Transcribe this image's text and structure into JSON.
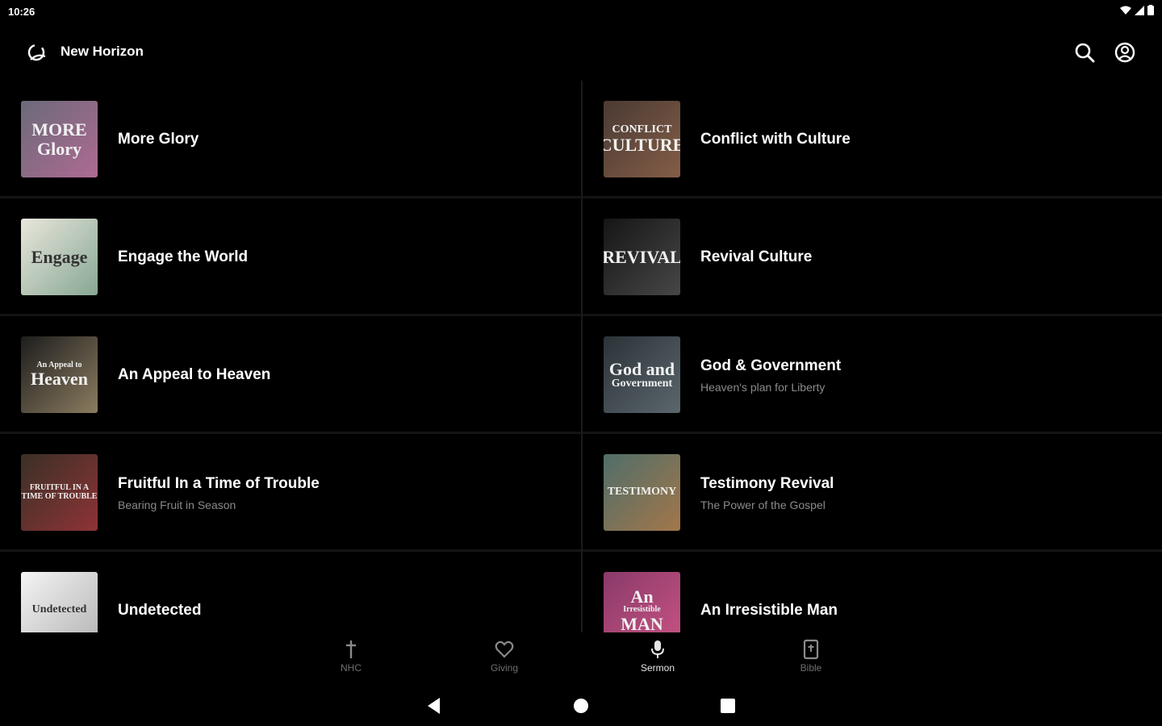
{
  "status_bar": {
    "time": "10:26"
  },
  "app_bar": {
    "title": "New Horizon",
    "logo_icon": "horizon-logo-icon",
    "search_icon": "search-icon",
    "account_icon": "account-circle-icon"
  },
  "series": [
    {
      "title": "More Glory",
      "subtitle": "",
      "thumb_text": [
        "MORE",
        "Glory"
      ],
      "thumb_bg": "#6b6a7a",
      "thumb_accent": "#c96a9c"
    },
    {
      "title": "Conflict with Culture",
      "subtitle": "",
      "thumb_text": [
        "CONFLICT",
        "CULTURE"
      ],
      "thumb_bg": "#4a3a33",
      "thumb_accent": "#9b6b4f"
    },
    {
      "title": "Engage the World",
      "subtitle": "",
      "thumb_text": [
        "Engage",
        ""
      ],
      "thumb_bg": "#e9e6dc",
      "thumb_accent": "#5f8f76"
    },
    {
      "title": "Revival Culture",
      "subtitle": "",
      "thumb_text": [
        "REVIVAL",
        ""
      ],
      "thumb_bg": "#161616",
      "thumb_accent": "#5a5a5a"
    },
    {
      "title": "An Appeal to Heaven",
      "subtitle": "",
      "thumb_text": [
        "An Appeal to",
        "Heaven"
      ],
      "thumb_bg": "#1d1d1d",
      "thumb_accent": "#b8a27b"
    },
    {
      "title": "God & Government",
      "subtitle": "Heaven's plan for Liberty",
      "thumb_text": [
        "God and",
        "Government"
      ],
      "thumb_bg": "#2b3338",
      "thumb_accent": "#6e7b82"
    },
    {
      "title": "Fruitful In a Time of Trouble",
      "subtitle": "Bearing Fruit in Season",
      "thumb_text": [
        "FRUITFUL IN A",
        "TIME OF TROUBLE"
      ],
      "thumb_bg": "#3a3026",
      "thumb_accent": "#b0343c"
    },
    {
      "title": "Testimony Revival",
      "subtitle": "The Power of the Gospel",
      "thumb_text": [
        "TESTIMONY",
        ""
      ],
      "thumb_bg": "#4f6e6a",
      "thumb_accent": "#c47a3c"
    },
    {
      "title": "Undetected",
      "subtitle": "",
      "thumb_text": [
        "Undetected",
        ""
      ],
      "thumb_bg": "#f4f4f4",
      "thumb_accent": "#9a9a9a"
    },
    {
      "title": "An Irresistible Man",
      "subtitle": "",
      "thumb_text": [
        "An",
        "Irresistible",
        "MAN"
      ],
      "thumb_bg": "#8a3a6a",
      "thumb_accent": "#e05d8c"
    }
  ],
  "bottom_nav": [
    {
      "label": "NHC",
      "icon": "cross-icon",
      "active": false
    },
    {
      "label": "Giving",
      "icon": "heart-icon",
      "active": false
    },
    {
      "label": "Sermon",
      "icon": "microphone-icon",
      "active": true
    },
    {
      "label": "Bible",
      "icon": "bible-icon",
      "active": false
    }
  ],
  "system_nav": {
    "back": "back-icon",
    "home": "home-icon",
    "recents": "recents-icon"
  }
}
